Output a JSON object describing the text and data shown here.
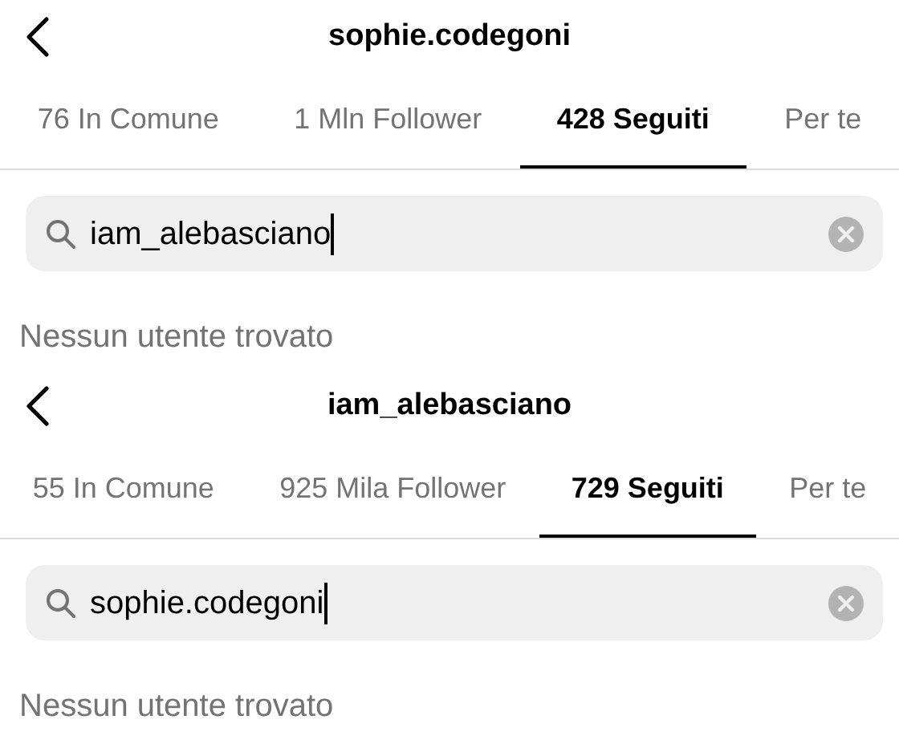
{
  "panels": [
    {
      "title": "sophie.codegoni",
      "tabs": [
        {
          "label": "76 In Comune",
          "selected": false
        },
        {
          "label": "1 Mln Follower",
          "selected": false
        },
        {
          "label": "428 Seguiti",
          "selected": true
        },
        {
          "label": "Per te",
          "selected": false
        }
      ],
      "search": {
        "value": "iam_alebasciano",
        "focused": true
      },
      "message": "Nessun utente trovato"
    },
    {
      "title": "iam_alebasciano",
      "tabs": [
        {
          "label": "55 In Comune",
          "selected": false
        },
        {
          "label": "925 Mila Follower",
          "selected": false
        },
        {
          "label": "729 Seguiti",
          "selected": true
        },
        {
          "label": "Per te",
          "selected": false
        }
      ],
      "search": {
        "value": "sophie.codegoni",
        "focused": true
      },
      "message": "Nessun utente trovato"
    }
  ]
}
